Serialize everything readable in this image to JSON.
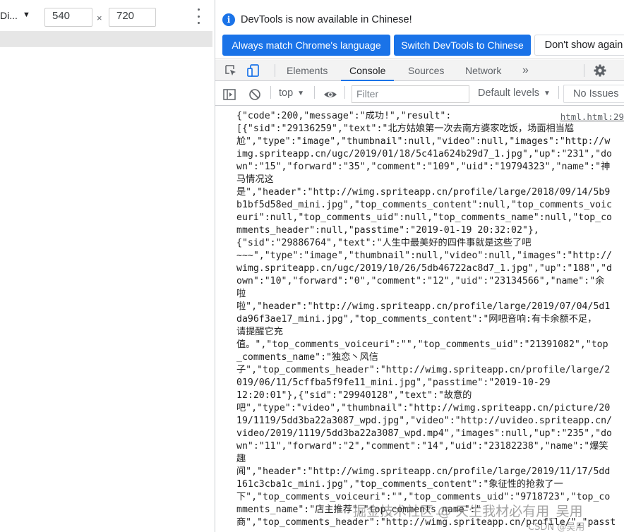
{
  "device_toolbar": {
    "device_label": "Di...",
    "width_value": "540",
    "height_value": "720",
    "times_symbol": "×"
  },
  "infobar": {
    "message": "DevTools is now available in Chinese!",
    "button_match": "Always match Chrome's language",
    "button_switch": "Switch DevTools to Chinese",
    "button_dismiss": "Don't show again"
  },
  "tabs": [
    {
      "label": "Elements"
    },
    {
      "label": "Console"
    },
    {
      "label": "Sources"
    },
    {
      "label": "Network"
    },
    {
      "label": "»"
    }
  ],
  "console_toolbar": {
    "context": "top",
    "filter_placeholder": "Filter",
    "levels": "Default levels",
    "issues": "No Issues"
  },
  "console": {
    "source_link": "html.html:29",
    "lines": [
      "{\"code\":200,\"message\":\"成功!\",\"result\":",
      "[{\"sid\":\"29136259\",\"text\":\"北方姑娘第一次去南方婆家吃饭，场面相当尴",
      "尬\",\"type\":\"image\",\"thumbnail\":null,\"video\":null,\"images\":\"http://w",
      "img.spriteapp.cn/ugc/2019/01/18/5c41a624b29d7_1.jpg\",\"up\":\"231\",\"do",
      "wn\":\"15\",\"forward\":\"35\",\"comment\":\"109\",\"uid\":\"19794323\",\"name\":\"神",
      "马情况这",
      "是\",\"header\":\"http://wimg.spriteapp.cn/profile/large/2018/09/14/5b9",
      "b1bf5d58ed_mini.jpg\",\"top_comments_content\":null,\"top_comments_voic",
      "euri\":null,\"top_comments_uid\":null,\"top_comments_name\":null,\"top_co",
      "mments_header\":null,\"passtime\":\"2019-01-19 20:32:02\"},",
      "{\"sid\":\"29886764\",\"text\":\"人生中最美好的四件事就是这些了吧",
      "~~~\",\"type\":\"image\",\"thumbnail\":null,\"video\":null,\"images\":\"http://",
      "wimg.spriteapp.cn/ugc/2019/10/26/5db46722ac8d7_1.jpg\",\"up\":\"188\",\"d",
      "own\":\"10\",\"forward\":\"0\",\"comment\":\"12\",\"uid\":\"23134566\",\"name\":\"余",
      "啦",
      "啦\",\"header\":\"http://wimg.spriteapp.cn/profile/large/2019/07/04/5d1",
      "da96f3ae17_mini.jpg\",\"top_comments_content\":\"网吧音响:有卡余额不足，",
      "请提醒它充",
      "值。\",\"top_comments_voiceuri\":\"\",\"top_comments_uid\":\"21391082\",\"top",
      "_comments_name\":\"独恋丶风信",
      "子\",\"top_comments_header\":\"http://wimg.spriteapp.cn/profile/large/2",
      "019/06/11/5cffba5f9fe11_mini.jpg\",\"passtime\":\"2019-10-29",
      "12:20:01\"},{\"sid\":\"29940128\",\"text\":\"故意的",
      "吧\",\"type\":\"video\",\"thumbnail\":\"http://wimg.spriteapp.cn/picture/20",
      "19/1119/5dd3ba22a3087_wpd.jpg\",\"video\":\"http://uvideo.spriteapp.cn/",
      "video/2019/1119/5dd3ba22a3087_wpd.mp4\",\"images\":null,\"up\":\"235\",\"do",
      "wn\":\"11\",\"forward\":\"2\",\"comment\":\"14\",\"uid\":\"23182238\",\"name\":\"爆笑",
      "趣",
      "闻\",\"header\":\"http://wimg.spriteapp.cn/profile/large/2019/11/17/5dd",
      "161c3cba1c_mini.jpg\",\"top_comments_content\":\"象征性的抢救了一",
      "下\",\"top_comments_voiceuri\":\"\",\"top_comments_uid\":\"9718723\",\"top_co",
      "mments_name\":\"店主推荐\",\"top_comments_name\":\"",
      "商\",\"top_comments_header\":\"http://wimg.spriteapp.cn/profile/\",\"passt"
    ]
  },
  "watermark": {
    "text": "掘金技术社区 @ 天生我材必有用_吴用",
    "csdn": "CSDN @吴用"
  },
  "colors": {
    "accent": "#1a73e8",
    "panel_bg": "#f3f3f3"
  }
}
